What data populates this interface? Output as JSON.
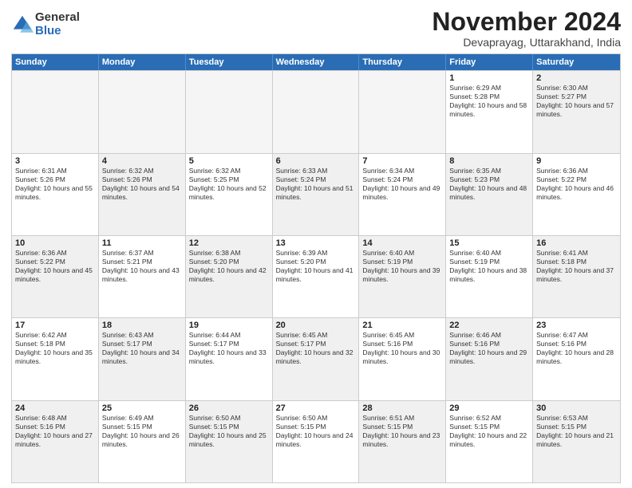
{
  "logo": {
    "general": "General",
    "blue": "Blue"
  },
  "header": {
    "month": "November 2024",
    "location": "Devaprayag, Uttarakhand, India"
  },
  "weekdays": [
    "Sunday",
    "Monday",
    "Tuesday",
    "Wednesday",
    "Thursday",
    "Friday",
    "Saturday"
  ],
  "rows": [
    [
      {
        "day": "",
        "info": "",
        "empty": true
      },
      {
        "day": "",
        "info": "",
        "empty": true
      },
      {
        "day": "",
        "info": "",
        "empty": true
      },
      {
        "day": "",
        "info": "",
        "empty": true
      },
      {
        "day": "",
        "info": "",
        "empty": true
      },
      {
        "day": "1",
        "info": "Sunrise: 6:29 AM\nSunset: 5:28 PM\nDaylight: 10 hours and 58 minutes."
      },
      {
        "day": "2",
        "info": "Sunrise: 6:30 AM\nSunset: 5:27 PM\nDaylight: 10 hours and 57 minutes.",
        "shade": true
      }
    ],
    [
      {
        "day": "3",
        "info": "Sunrise: 6:31 AM\nSunset: 5:26 PM\nDaylight: 10 hours and 55 minutes."
      },
      {
        "day": "4",
        "info": "Sunrise: 6:32 AM\nSunset: 5:26 PM\nDaylight: 10 hours and 54 minutes.",
        "shade": true
      },
      {
        "day": "5",
        "info": "Sunrise: 6:32 AM\nSunset: 5:25 PM\nDaylight: 10 hours and 52 minutes."
      },
      {
        "day": "6",
        "info": "Sunrise: 6:33 AM\nSunset: 5:24 PM\nDaylight: 10 hours and 51 minutes.",
        "shade": true
      },
      {
        "day": "7",
        "info": "Sunrise: 6:34 AM\nSunset: 5:24 PM\nDaylight: 10 hours and 49 minutes."
      },
      {
        "day": "8",
        "info": "Sunrise: 6:35 AM\nSunset: 5:23 PM\nDaylight: 10 hours and 48 minutes.",
        "shade": true
      },
      {
        "day": "9",
        "info": "Sunrise: 6:36 AM\nSunset: 5:22 PM\nDaylight: 10 hours and 46 minutes."
      }
    ],
    [
      {
        "day": "10",
        "info": "Sunrise: 6:36 AM\nSunset: 5:22 PM\nDaylight: 10 hours and 45 minutes.",
        "shade": true
      },
      {
        "day": "11",
        "info": "Sunrise: 6:37 AM\nSunset: 5:21 PM\nDaylight: 10 hours and 43 minutes."
      },
      {
        "day": "12",
        "info": "Sunrise: 6:38 AM\nSunset: 5:20 PM\nDaylight: 10 hours and 42 minutes.",
        "shade": true
      },
      {
        "day": "13",
        "info": "Sunrise: 6:39 AM\nSunset: 5:20 PM\nDaylight: 10 hours and 41 minutes."
      },
      {
        "day": "14",
        "info": "Sunrise: 6:40 AM\nSunset: 5:19 PM\nDaylight: 10 hours and 39 minutes.",
        "shade": true
      },
      {
        "day": "15",
        "info": "Sunrise: 6:40 AM\nSunset: 5:19 PM\nDaylight: 10 hours and 38 minutes."
      },
      {
        "day": "16",
        "info": "Sunrise: 6:41 AM\nSunset: 5:18 PM\nDaylight: 10 hours and 37 minutes.",
        "shade": true
      }
    ],
    [
      {
        "day": "17",
        "info": "Sunrise: 6:42 AM\nSunset: 5:18 PM\nDaylight: 10 hours and 35 minutes."
      },
      {
        "day": "18",
        "info": "Sunrise: 6:43 AM\nSunset: 5:17 PM\nDaylight: 10 hours and 34 minutes.",
        "shade": true
      },
      {
        "day": "19",
        "info": "Sunrise: 6:44 AM\nSunset: 5:17 PM\nDaylight: 10 hours and 33 minutes."
      },
      {
        "day": "20",
        "info": "Sunrise: 6:45 AM\nSunset: 5:17 PM\nDaylight: 10 hours and 32 minutes.",
        "shade": true
      },
      {
        "day": "21",
        "info": "Sunrise: 6:45 AM\nSunset: 5:16 PM\nDaylight: 10 hours and 30 minutes."
      },
      {
        "day": "22",
        "info": "Sunrise: 6:46 AM\nSunset: 5:16 PM\nDaylight: 10 hours and 29 minutes.",
        "shade": true
      },
      {
        "day": "23",
        "info": "Sunrise: 6:47 AM\nSunset: 5:16 PM\nDaylight: 10 hours and 28 minutes."
      }
    ],
    [
      {
        "day": "24",
        "info": "Sunrise: 6:48 AM\nSunset: 5:16 PM\nDaylight: 10 hours and 27 minutes.",
        "shade": true
      },
      {
        "day": "25",
        "info": "Sunrise: 6:49 AM\nSunset: 5:15 PM\nDaylight: 10 hours and 26 minutes."
      },
      {
        "day": "26",
        "info": "Sunrise: 6:50 AM\nSunset: 5:15 PM\nDaylight: 10 hours and 25 minutes.",
        "shade": true
      },
      {
        "day": "27",
        "info": "Sunrise: 6:50 AM\nSunset: 5:15 PM\nDaylight: 10 hours and 24 minutes."
      },
      {
        "day": "28",
        "info": "Sunrise: 6:51 AM\nSunset: 5:15 PM\nDaylight: 10 hours and 23 minutes.",
        "shade": true
      },
      {
        "day": "29",
        "info": "Sunrise: 6:52 AM\nSunset: 5:15 PM\nDaylight: 10 hours and 22 minutes."
      },
      {
        "day": "30",
        "info": "Sunrise: 6:53 AM\nSunset: 5:15 PM\nDaylight: 10 hours and 21 minutes.",
        "shade": true
      }
    ]
  ]
}
